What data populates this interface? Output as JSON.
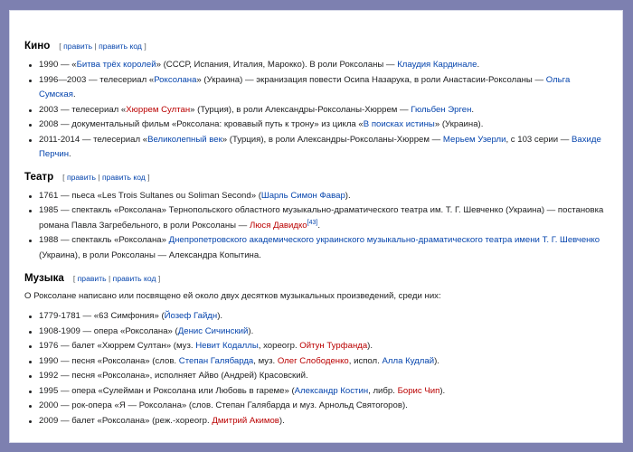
{
  "sections": {
    "kino": {
      "title": "Кино",
      "edit_open": "[ ",
      "edit_link1": "править",
      "edit_sep": " | ",
      "edit_link2": "править код",
      "edit_close": " ]",
      "items": [
        {
          "p1": "1990 — «",
          "l1": "Битва трёх королей",
          "p2": "» (СССР, Испания, Италия, Марокко). В роли Роксоланы — ",
          "l2": "Клаудия Кардинале",
          "p3": "."
        },
        {
          "p1": "1996—2003 — телесериал «",
          "l1": "Роксолана",
          "p2": "» (Украина) — экранизация повести Осипа Назарука, в роли Анастасии-Роксоланы — ",
          "l2": "Ольга Сумская",
          "p3": "."
        },
        {
          "p1": "2003 — телесериал «",
          "l1": "Хюррем Султан",
          "p2": "» (Турция), в роли Александры-Роксоланы-Хюррем — ",
          "l2": "Гюльбен Эрген",
          "p3": "."
        },
        {
          "p1": "2008 — документальный фильм «Роксолана: кровавый путь к трону» из цикла «",
          "l1": "В поисках истины",
          "p2": "» (Украина)."
        },
        {
          "p1": "2011-2014 — телесериал «",
          "l1": "Великолепный век",
          "p2": "» (Турция), в роли Александры-Роксоланы-Хюррем — ",
          "l2": "Мерьем Узерли",
          "p3": ", с 103 серии — ",
          "l3": "Вахиде Перчин",
          "p4": "."
        }
      ]
    },
    "teatr": {
      "title": "Театр",
      "edit_open": "[ ",
      "edit_link1": "править",
      "edit_sep": " | ",
      "edit_link2": "править код",
      "edit_close": " ]",
      "items": [
        {
          "p1": "1761 — пьеса «Les Trois Sultanes ou Soliman Second» (",
          "l1": "Шарль Симон Фавар",
          "p2": ")."
        },
        {
          "p1": "1985 — спектакль «Роксолана» Тернопольского областного музыкально-драматического театра им. Т. Г. Шевченко (Украина) — постановка романа Павла Загребельного, в роли Роксоланы — ",
          "l1": "Люся Давидко",
          "sup": "[43]",
          "p2": "."
        },
        {
          "p1": "1988 — спектакль «Роксолана» ",
          "l1": "Днепропетровского академического украинского музыкально-драматического театра имени Т. Г. Шевченко",
          "p2": " (Украина), в роли Роксоланы — Александра Копытина."
        }
      ]
    },
    "music": {
      "title": "Музыка",
      "edit_open": "[ ",
      "edit_link1": "править",
      "edit_sep": " | ",
      "edit_link2": "править код",
      "edit_close": " ]",
      "intro": "О Роксолане написано или посвящено ей около двух десятков музыкальных произведений, среди них:",
      "items": [
        {
          "p1": "1779-1781 — «63 Симфония» (",
          "l1": "Йозеф Гайдн",
          "p2": ")."
        },
        {
          "p1": "1908-1909 — опера «Роксолана» (",
          "l1": "Денис Сичинский",
          "p2": ")."
        },
        {
          "p1": "1976 — балет «Хюррем Султан» (муз. ",
          "l1": "Невит Кодаллы",
          "p2": ", хореогр. ",
          "l2": "Ойтун Турфанда",
          "p3": ")."
        },
        {
          "p1": "1990 — песня «Роксолана» (слов. ",
          "l1": "Степан Галябарда",
          "p2": ", муз. ",
          "l2": "Олег Слободенко",
          "p3": ", испол. ",
          "l3": "Алла Кудлай",
          "p4": ")."
        },
        {
          "p1": "1992 — песня «Роксолана», исполняет Айво (Андрей) Красовский."
        },
        {
          "p1": "1995 — опера «Сулейман и Роксолана или Любовь в гареме» (",
          "l1": "Александр Костин",
          "p2": ", либр. ",
          "l2": "Борис Чип",
          "p3": ")."
        },
        {
          "p1": "2000 — рок-опера «Я — Роксолана» (слов. Степан Галябарда и муз. Арнольд Святогоров)."
        },
        {
          "p1": "2009 — балет «Роксолана» (реж.-хореогр. ",
          "l1": "Дмитрий Акимов",
          "p2": ")."
        }
      ]
    }
  },
  "colors": {
    "link": "#0645ad",
    "redlink": "#ba0000",
    "frame": "#7d80b0"
  }
}
